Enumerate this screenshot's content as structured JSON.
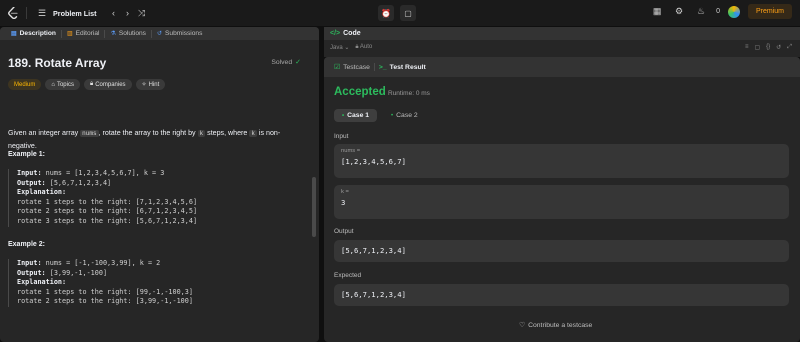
{
  "topbar": {
    "problem_list_label": "Problem List",
    "streak_count": "0",
    "premium_label": "Premium"
  },
  "left": {
    "tabs": [
      {
        "label": "Description"
      },
      {
        "label": "Editorial"
      },
      {
        "label": "Solutions"
      },
      {
        "label": "Submissions"
      }
    ],
    "title": "189. Rotate Array",
    "solved_label": "Solved",
    "chips": {
      "difficulty": "Medium",
      "topics": "Topics",
      "companies": "Companies",
      "hint": "Hint"
    },
    "description": {
      "part1": "Given an integer array ",
      "code1": "nums",
      "part2": ", rotate the array to the right by ",
      "code2": "k",
      "part3": " steps, where ",
      "code3": "k",
      "part4": " is non-negative."
    },
    "examples": [
      {
        "title": "Example 1:",
        "input_label": "Input:",
        "input": "nums = [1,2,3,4,5,6,7], k = 3",
        "output_label": "Output:",
        "output": "[5,6,7,1,2,3,4]",
        "explanation_label": "Explanation:",
        "lines": [
          "rotate 1 steps to the right: [7,1,2,3,4,5,6]",
          "rotate 2 steps to the right: [6,7,1,2,3,4,5]",
          "rotate 3 steps to the right: [5,6,7,1,2,3,4]"
        ]
      },
      {
        "title": "Example 2:",
        "input_label": "Input:",
        "input": "nums = [-1,-100,3,99], k = 2",
        "output_label": "Output:",
        "output": "[3,99,-1,-100]",
        "explanation_label": "Explanation:",
        "lines": [
          "rotate 1 steps to the right: [99,-1,-100,3]",
          "rotate 2 steps to the right: [3,99,-1,-100]"
        ]
      }
    ]
  },
  "code": {
    "title": "Code",
    "language": "Java",
    "mode": "Auto"
  },
  "result": {
    "tabs": [
      {
        "label": "Testcase"
      },
      {
        "label": "Test Result"
      }
    ],
    "status": "Accepted",
    "runtime": "Runtime: 0 ms",
    "cases": [
      {
        "label": "Case 1"
      },
      {
        "label": "Case 2"
      }
    ],
    "input_label": "Input",
    "nums_label": "nums =",
    "nums_value": "[1,2,3,4,5,6,7]",
    "k_label": "k =",
    "k_value": "3",
    "output_label": "Output",
    "output_value": "[5,6,7,1,2,3,4]",
    "expected_label": "Expected",
    "expected_value": "[5,6,7,1,2,3,4]",
    "contribute_label": "Contribute a testcase"
  },
  "colors": {
    "accent_green": "#2cbb5d",
    "accent_orange": "#ffa116",
    "medium_yellow": "#ffb800"
  }
}
